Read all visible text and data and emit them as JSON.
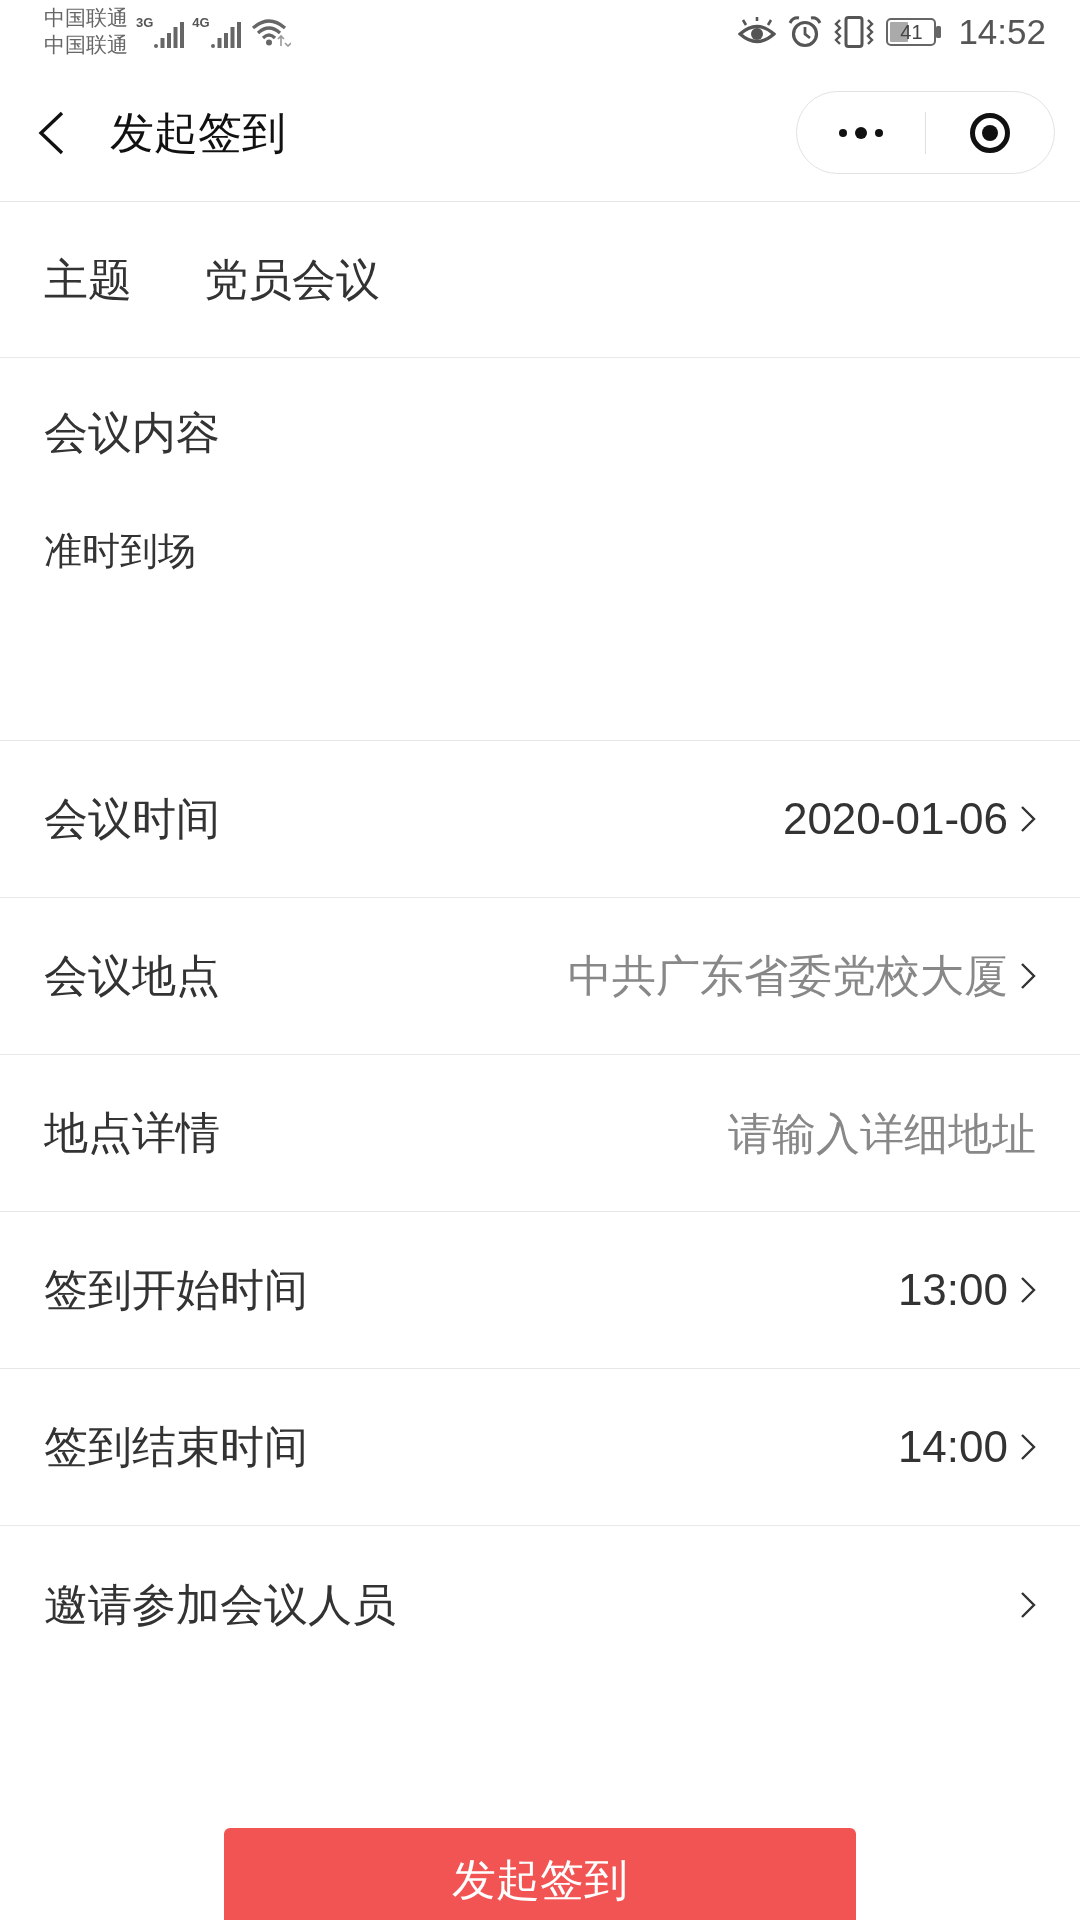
{
  "status_bar": {
    "carriers": [
      "中国联通",
      "中国联通"
    ],
    "networks": [
      {
        "type": "3G"
      },
      {
        "type": "4G"
      }
    ],
    "battery": "41",
    "time": "14:52"
  },
  "nav_bar": {
    "title": "发起签到"
  },
  "subject": {
    "label": "主题",
    "value": "党员会议"
  },
  "content": {
    "label": "会议内容",
    "value": "准时到场"
  },
  "rows": [
    {
      "kind": "picker",
      "label": "会议时间",
      "value": "2020-01-06",
      "muted": false
    },
    {
      "kind": "picker",
      "label": "会议地点",
      "value": "中共广东省委党校大厦",
      "muted": true
    },
    {
      "kind": "input",
      "label": "地点详情",
      "placeholder": "请输入详细地址"
    },
    {
      "kind": "picker",
      "label": "签到开始时间",
      "value": "13:00",
      "muted": false
    },
    {
      "kind": "picker",
      "label": "签到结束时间",
      "value": "14:00",
      "muted": false
    },
    {
      "kind": "link",
      "label": "邀请参加会议人员"
    }
  ],
  "submit_button": {
    "label": "发起签到"
  }
}
